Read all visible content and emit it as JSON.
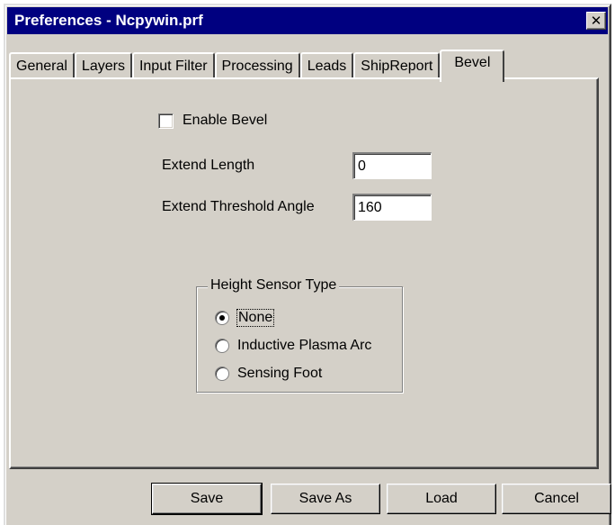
{
  "window": {
    "title": "Preferences - Ncpywin.prf",
    "close_label": "✕"
  },
  "tabs": [
    {
      "label": "General"
    },
    {
      "label": "Layers"
    },
    {
      "label": "Input Filter"
    },
    {
      "label": "Processing"
    },
    {
      "label": "Leads"
    },
    {
      "label": "ShipReport"
    },
    {
      "label": "Bevel",
      "active": true
    }
  ],
  "bevel": {
    "enable_label": "Enable Bevel",
    "enable_checked": false,
    "extend_length_label": "Extend Length",
    "extend_length_value": "0",
    "extend_threshold_label": "Extend Threshold Angle",
    "extend_threshold_value": "160",
    "height_sensor": {
      "title": "Height Sensor Type",
      "options": [
        {
          "label": "None",
          "selected": true
        },
        {
          "label": "Inductive Plasma Arc",
          "selected": false
        },
        {
          "label": "Sensing Foot",
          "selected": false
        }
      ]
    }
  },
  "buttons": {
    "save": "Save",
    "save_as": "Save As",
    "load": "Load",
    "cancel": "Cancel"
  },
  "colors": {
    "title_bar": "#000080",
    "face": "#d4d0c8"
  }
}
